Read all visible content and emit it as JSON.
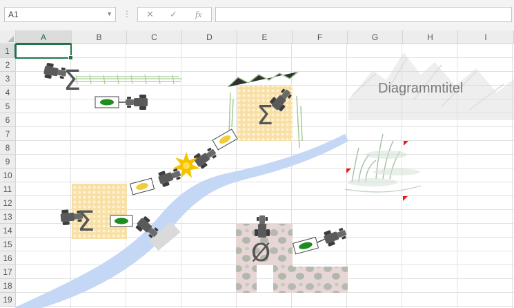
{
  "formula_bar": {
    "name_box": "A1",
    "cancel_icon": "✕",
    "enter_icon": "✓",
    "fx_icon": "fx",
    "formula": ""
  },
  "grid": {
    "columns": [
      "A",
      "B",
      "C",
      "D",
      "E",
      "F",
      "G",
      "H",
      "I"
    ],
    "rows": [
      "1",
      "2",
      "3",
      "4",
      "5",
      "6",
      "7",
      "8",
      "9",
      "10",
      "11",
      "12",
      "13",
      "14",
      "15",
      "16",
      "17",
      "18",
      "19"
    ],
    "active_cell": "A1"
  },
  "drawing": {
    "chart_title": "Diagrammtitel",
    "symbols": [
      "Σ",
      "Σ",
      "Σ",
      "Ø"
    ]
  },
  "colors": {
    "excel_green": "#217346",
    "river": "#c4d7f5",
    "field_yellow": "#f8e0a4",
    "field_pink": "#e8d6d6",
    "tractor": "#555555",
    "sign_green": "#1f8c1f",
    "sign_yellow": "#f2cd3a"
  }
}
